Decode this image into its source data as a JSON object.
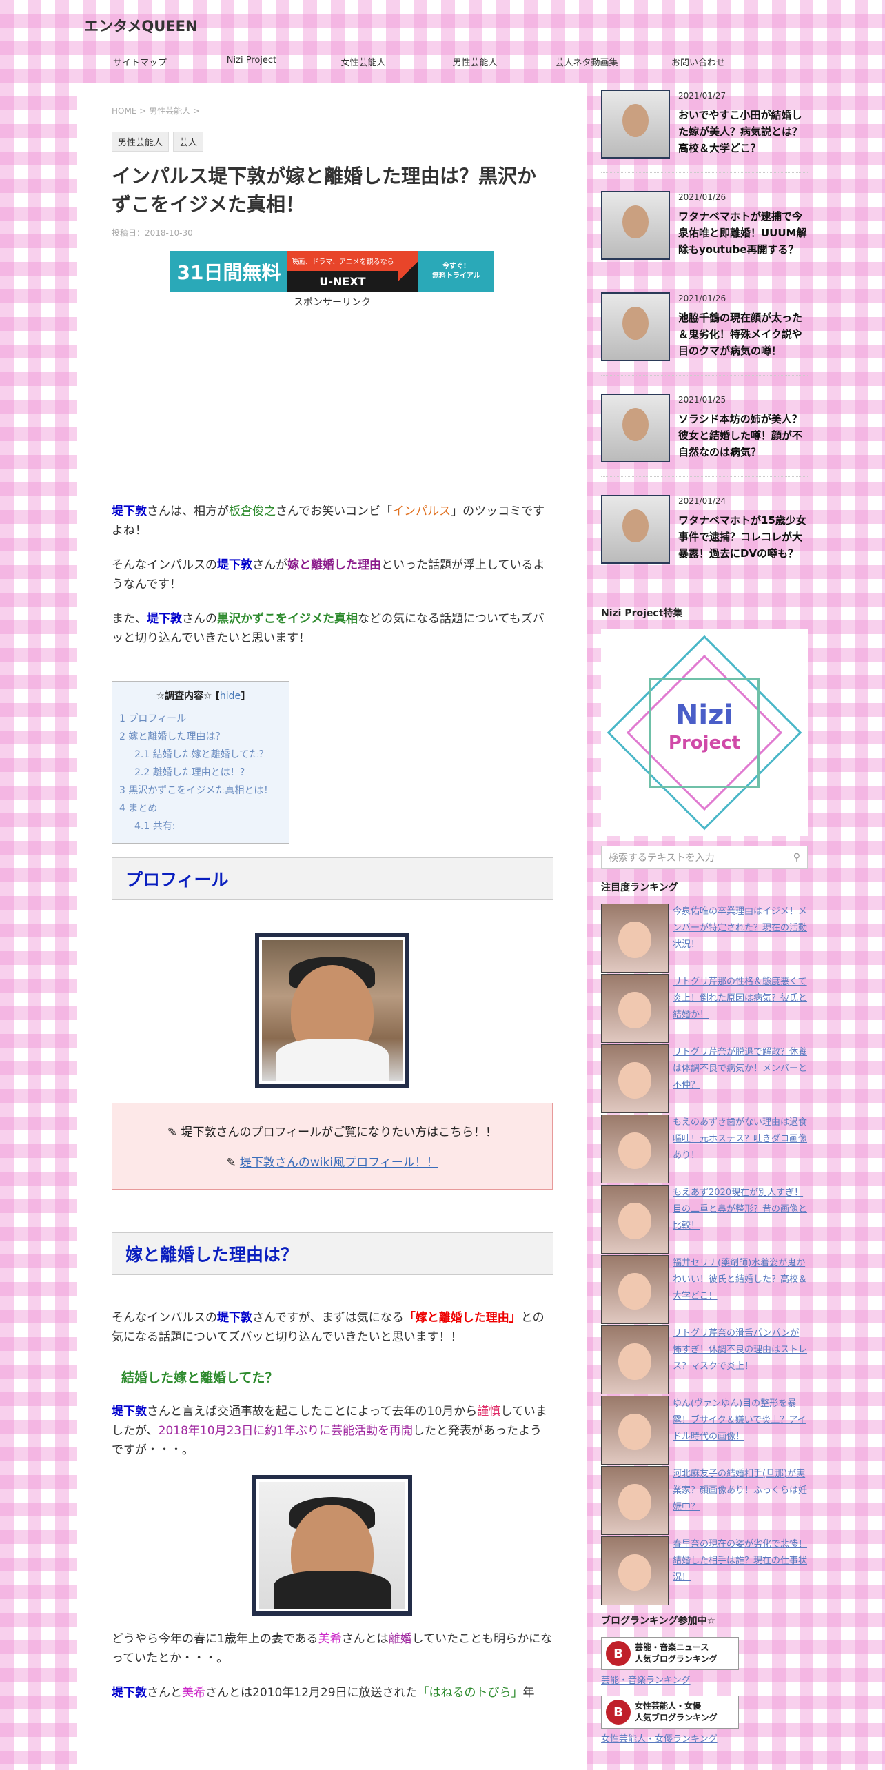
{
  "site": {
    "title": "エンタメQUEEN"
  },
  "nav": [
    "サイトマップ",
    "Nizi Project",
    "女性芸能人",
    "男性芸能人",
    "芸人ネタ動画集",
    "お問い合わせ"
  ],
  "breadcrumb": "HOME > 男性芸能人 >",
  "tags": [
    "男性芸能人",
    "芸人"
  ],
  "post": {
    "title": "インパルス堤下敦が嫁と離婚した理由は？黒沢かずこをイジメた真相！",
    "date": "投稿日：2018-10-30"
  },
  "ad": {
    "left": "31日間無料",
    "mid_top": "映画、ドラマ、アニメを観るなら",
    "mid_bot": "U-NEXT",
    "right": "今すぐ！\n無料トライアル",
    "sponsor": "スポンサーリンク"
  },
  "intro": {
    "p1": {
      "a": "堤下敦",
      "b": "さんは、相方が",
      "c": "板倉俊之",
      "d": "さんでお笑いコンビ「",
      "e": "インパルス",
      "f": "」のツッコミですよね！"
    },
    "p2": {
      "a": "そんなインパルスの",
      "b": "堤下敦",
      "c": "さんが",
      "d": "嫁と離婚した理由",
      "e": "といった話題が浮上しているようなんです！"
    },
    "p3": {
      "a": "また、",
      "b": "堤下敦",
      "c": "さんの",
      "d": "黒沢かずこをイジメた真相",
      "e": "などの気になる話題についてもズバッと切り込んでいきたいと思います！"
    }
  },
  "toc": {
    "title": "☆調査内容☆",
    "hide": "hide",
    "items": [
      "1 プロフィール",
      "2 嫁と離婚した理由は？",
      "2.1 結婚した嫁と離婚してた？",
      "2.2 離婚した理由とは！？",
      "3 黒沢かずこをイジメた真相とは！",
      "4 まとめ",
      "4.1 共有:"
    ]
  },
  "sections": {
    "profile_heading": "プロフィール",
    "note1": "堤下敦さんのプロフィールがご覧になりたい方はこちら！！",
    "note2": "堤下敦さんのwiki風プロフィール！！",
    "divorce_heading": "嫁と離婚した理由は？",
    "divorce_p": {
      "a": "そんなインパルスの",
      "b": "堤下敦",
      "c": "さんですが、まずは気になる",
      "d": "「嫁と離婚した理由」",
      "e": "との気になる話題についてズバッと切り込んでいきたいと思います！！"
    },
    "h3_married": "結婚した嫁と離婚してた？",
    "married_p": {
      "a": "堤下敦",
      "b": "さんと言えば交通事故を起こしたことによって去年の10月から",
      "c": "謹慎",
      "d": "していましたが、",
      "e": "2018年10月23日に約1年ぶりに芸能活動を再開",
      "f": "したと発表があったようですが・・・。"
    },
    "after_p": {
      "a": "どうやら今年の春に1歳年上の妻である",
      "b": "美希",
      "c": "さんとは",
      "d": "離婚",
      "e": "していたことも明らかになっていたとか・・・。"
    },
    "last_p": {
      "a": "堤下敦",
      "b": "さんと",
      "c": "美希",
      "d": "さんとは2010年12月29日に放送された",
      "e": "「はねるのトびら」",
      "f": "年"
    }
  },
  "sidebar": {
    "posts": [
      {
        "date": "2021/01/27",
        "title": "おいでやすこ小田が結婚した嫁が美人？病気説とは？高校＆大学どこ？"
      },
      {
        "date": "2021/01/26",
        "title": "ワタナベマホトが逮捕で今泉佑唯と即離婚！UUUM解除もyoutube再開する？"
      },
      {
        "date": "2021/01/26",
        "title": "池脇千鶴の現在顔が太った＆鬼劣化！特殊メイク説や目のクマが病気の噂！"
      },
      {
        "date": "2021/01/25",
        "title": "ソラシド本坊の姉が美人？彼女と結婚した噂！顔が不自然なのは病気？"
      },
      {
        "date": "2021/01/24",
        "title": "ワタナベマホトが15歳少女事件で逮捕？コレコレが大暴露！過去にDVの噂も？"
      }
    ],
    "nizi_heading": "Nizi Project特集",
    "nizi_logo": [
      "Nizi",
      "Project"
    ],
    "search_placeholder": "検索するテキストを入力",
    "ranking_heading": "注目度ランキング",
    "ranking": [
      "今泉佑唯の卒業理由はイジメ！メンバーが特定された？現在の活動状況！",
      "リトグリ芹那の性格＆態度悪くて炎上！倒れた原因は病気？彼氏と結婚か！",
      "リトグリ芹奈が脱退で解散？休養は体調不良で病気か！メンバーと不仲？",
      "もえのあずき歯がない理由は過食嘔吐！元ホステス？吐きダコ画像あり！",
      "もえあず2020現在が別人すぎ！目の二重と鼻が整形？昔の画像と比較！",
      "福井セリナ(薬剤師)水着姿が鬼かわいい！彼氏と結婚した？高校＆大学どこ！",
      "リトグリ芹奈の滑舌パンパンが怖すぎ！休調不良の理由はストレス？マスクで炎上！",
      "ゆん(ヴァンゆん)目の整形を暴露！ブサイク＆嫌いで炎上？アイドル時代の画像！",
      "河北麻友子の結婚相手(旦那)が実業家？顔画像あり！ふっくらは妊娠中？",
      "春里奈の現在の姿が劣化で悲惨！結婚した相手は誰？現在の仕事状況！"
    ],
    "blog_heading": "ブログランキング参加中☆",
    "blogs": [
      {
        "banner": "芸能・音楽ニュース\n人気ブログランキング",
        "link": "芸能・音楽ランキング"
      },
      {
        "banner": "女性芸能人・女優\n人気ブログランキング",
        "link": "女性芸能人・女優ランキング"
      }
    ]
  }
}
